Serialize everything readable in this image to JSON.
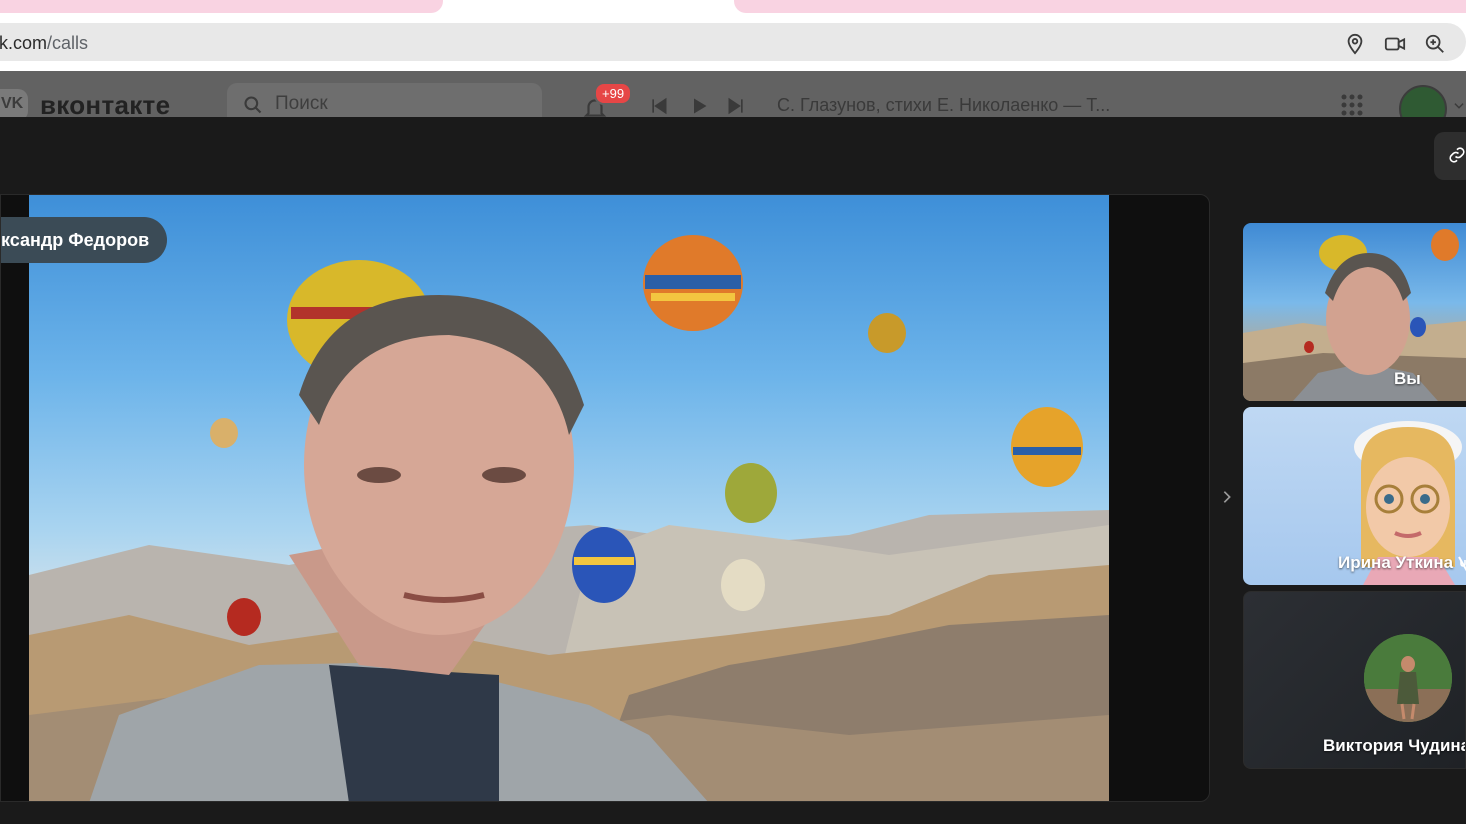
{
  "browser": {
    "url_host": "vk.com",
    "url_path": "/calls",
    "icons": [
      "location-icon",
      "camera-icon",
      "zoom-icon"
    ]
  },
  "vk_header": {
    "brand": "вконтакте",
    "search_placeholder": "Поиск",
    "notification_badge": "+99",
    "now_playing": "С. Глазунов, стихи Е. Николаенко — Т..."
  },
  "call": {
    "speaker_name": "ксандр Федоров",
    "participants": [
      {
        "label": "Вы"
      },
      {
        "label": "Ирина Уткина"
      },
      {
        "label": "Виктория Чудина"
      }
    ]
  },
  "colors": {
    "background": "#1a1a1a",
    "tab_pink": "#f9d3e2",
    "badge_red": "#e64646",
    "name_pill": "#3b4b56"
  }
}
